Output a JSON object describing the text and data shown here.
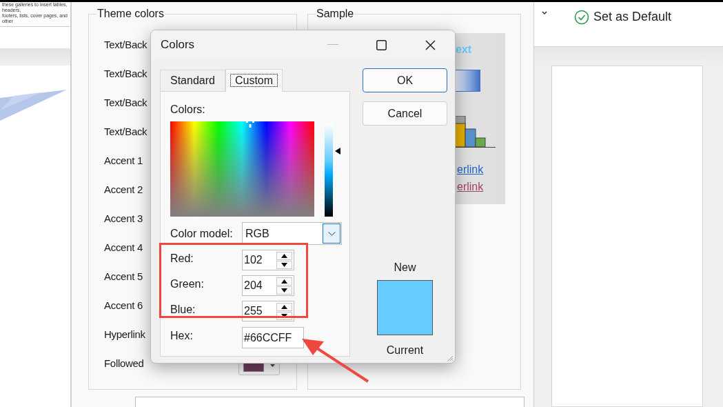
{
  "document_preview": {
    "lines": [
      "these galleries to insert tables, headers,",
      "footers, lists, cover pages, and other"
    ]
  },
  "ribbon": {
    "set_default": "Set as Default"
  },
  "theme_dialog": {
    "theme_group": "Theme colors",
    "theme_rows": [
      {
        "label": "Text/Back"
      },
      {
        "label": "Text/Back"
      },
      {
        "label": "Text/Back"
      },
      {
        "label": "Text/Back"
      },
      {
        "label": "Accent 1"
      },
      {
        "label": "Accent 2"
      },
      {
        "label": "Accent 3"
      },
      {
        "label": "Accent 4"
      },
      {
        "label": "Accent 5"
      },
      {
        "label": "Accent 6"
      },
      {
        "label": "Hyperlink"
      },
      {
        "label": "Followed",
        "color": "#6e3a5a"
      }
    ],
    "sample_group": "Sample",
    "sample": {
      "text": "ext",
      "hyperlink": "erlink",
      "followed_hyperlink": "erlink"
    }
  },
  "colors_dialog": {
    "title": "Colors",
    "tabs": [
      {
        "label": "Standard",
        "selected": false
      },
      {
        "label": "Custom",
        "selected": true
      }
    ],
    "colors_label": {
      "text": "Colors:"
    },
    "color_model": {
      "label": "Color model:",
      "value": "RGB"
    },
    "channels": [
      {
        "label": "Red:",
        "value": "102"
      },
      {
        "label": "Green:",
        "value": "204"
      },
      {
        "label": "Blue:",
        "value": "255"
      }
    ],
    "hex": {
      "label": "Hex:",
      "value": "#66CCFF"
    },
    "buttons": [
      {
        "label": "OK",
        "default": true
      },
      {
        "label": "Cancel",
        "default": false
      }
    ],
    "new_label": "New",
    "current_label": "Current",
    "color": "#66ccff"
  }
}
